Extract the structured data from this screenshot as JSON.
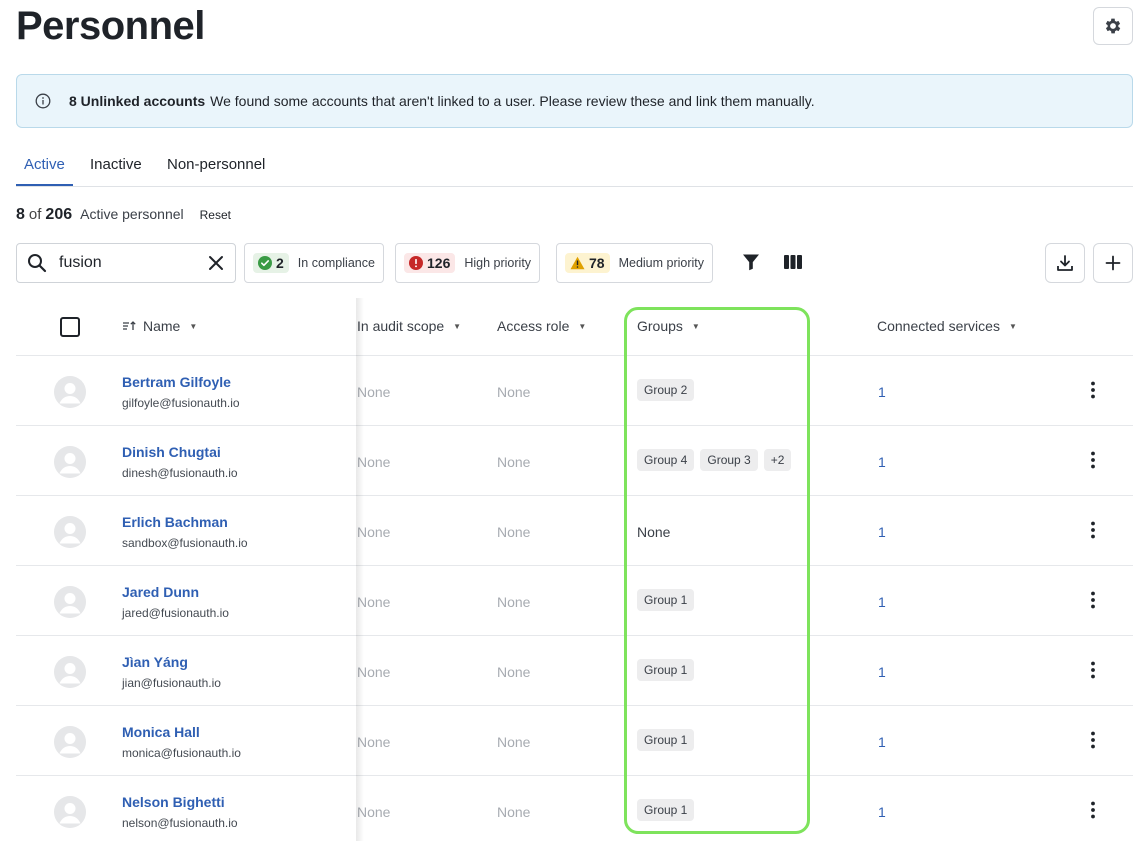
{
  "page": {
    "title": "Personnel"
  },
  "banner": {
    "bold": "8 Unlinked accounts",
    "text": "We found some accounts that aren't linked to a user. Please review these and link them manually."
  },
  "tabs": [
    {
      "label": "Active",
      "active": true
    },
    {
      "label": "Inactive",
      "active": false
    },
    {
      "label": "Non-personnel",
      "active": false
    }
  ],
  "summary": {
    "shown": "8",
    "of": "of",
    "total": "206",
    "label": "Active personnel",
    "reset": "Reset"
  },
  "search": {
    "value": "fusion",
    "icon": "search-icon"
  },
  "filters": [
    {
      "count": "2",
      "label": "In compliance",
      "icon": "check-circle-icon",
      "color": "#3a9b45"
    },
    {
      "count": "126",
      "label": "High priority",
      "icon": "alert-circle-icon",
      "color": "#c62828"
    },
    {
      "count": "78",
      "label": "Medium priority",
      "icon": "warning-triangle-icon",
      "color": "#e0a100"
    }
  ],
  "table": {
    "columns": {
      "name": "Name",
      "audit_scope": "In audit scope",
      "access_role": "Access role",
      "groups": "Groups",
      "connected_services": "Connected services"
    },
    "rows": [
      {
        "name": "Bertram Gilfoyle",
        "email": "gilfoyle@fusionauth.io",
        "audit": "None",
        "role": "None",
        "groups": [
          "Group 2"
        ],
        "groups_none": "",
        "services": "1"
      },
      {
        "name": "Dinish Chugtai",
        "email": "dinesh@fusionauth.io",
        "audit": "None",
        "role": "None",
        "groups": [
          "Group 4",
          "Group 3",
          "+2"
        ],
        "groups_none": "",
        "services": "1"
      },
      {
        "name": "Erlich Bachman",
        "email": "sandbox@fusionauth.io",
        "audit": "None",
        "role": "None",
        "groups": [],
        "groups_none": "None",
        "services": "1"
      },
      {
        "name": "Jared Dunn",
        "email": "jared@fusionauth.io",
        "audit": "None",
        "role": "None",
        "groups": [
          "Group 1"
        ],
        "groups_none": "",
        "services": "1"
      },
      {
        "name": "Jìan Yáng",
        "email": "jian@fusionauth.io",
        "audit": "None",
        "role": "None",
        "groups": [
          "Group 1"
        ],
        "groups_none": "",
        "services": "1"
      },
      {
        "name": "Monica Hall",
        "email": "monica@fusionauth.io",
        "audit": "None",
        "role": "None",
        "groups": [
          "Group 1"
        ],
        "groups_none": "",
        "services": "1"
      },
      {
        "name": "Nelson Bighetti",
        "email": "nelson@fusionauth.io",
        "audit": "None",
        "role": "None",
        "groups": [
          "Group 1"
        ],
        "groups_none": "",
        "services": "1"
      }
    ]
  },
  "colors": {
    "link": "#2f5fb3",
    "highlight": "#7ee35c",
    "banner_bg": "#eaf5fb"
  }
}
